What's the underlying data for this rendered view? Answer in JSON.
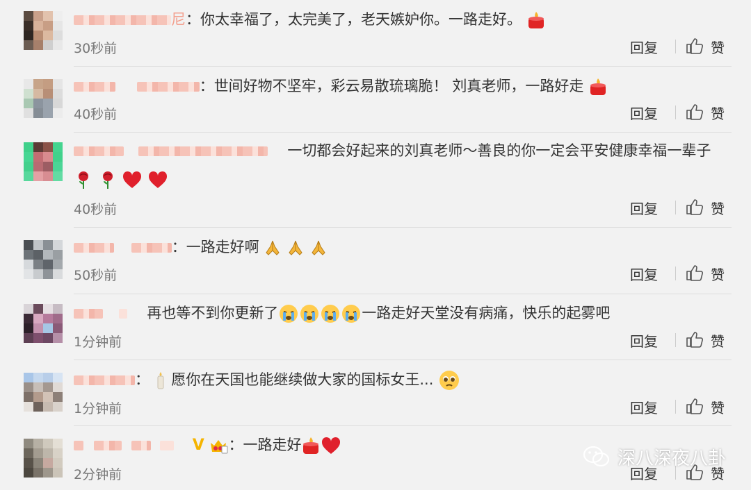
{
  "comments": [
    {
      "text": "你太幸福了，太完美了，老天嫉妒你。一路走好。",
      "time": "30秒前",
      "user_suffix": "尼",
      "emoji_after": [
        "candle-emoji"
      ]
    },
    {
      "text": "世间好物不坚牢，彩云易散琉璃脆！  刘真老师，一路好走",
      "time": "40秒前",
      "emoji_after": [
        "candle-emoji"
      ]
    },
    {
      "text": "一切都会好起来的刘真老师～善良的你一定会平安健康幸福一辈子",
      "time": "40秒前",
      "emoji_after": [
        "rose-emoji",
        "rose-emoji",
        "heart-emoji",
        "heart-emoji"
      ]
    },
    {
      "text": "一路走好啊",
      "time": "50秒前",
      "emoji_after": [
        "pray-emoji",
        "pray-emoji",
        "pray-emoji"
      ]
    },
    {
      "text_before": "再也等不到你更新了",
      "text_after": "一路走好天堂没有病痛，快乐的起雾吧",
      "time": "1分钟前",
      "emoji_mid": [
        "crying-emoji",
        "crying-emoji",
        "crying-emoji",
        "crying-emoji"
      ]
    },
    {
      "text": "愿你在天国也能继续做大家的国标女王...",
      "time": "1分钟前",
      "emoji_before": [
        "candle-small-emoji"
      ],
      "emoji_after": [
        "pleading-emoji"
      ]
    },
    {
      "text": "一路走好",
      "time": "2分钟前",
      "emoji_after": [
        "candle-emoji",
        "heart-emoji"
      ],
      "badges": [
        "v-badge",
        "crown-badge"
      ]
    }
  ],
  "actions": {
    "reply_label": "回复",
    "like_label": "赞"
  },
  "watermark": {
    "text": "深八深夜八卦"
  },
  "colors": {
    "blur": "#f6c3b8",
    "time": "#777777",
    "divider": "#dcdcdc",
    "heart": "#e0202c"
  }
}
